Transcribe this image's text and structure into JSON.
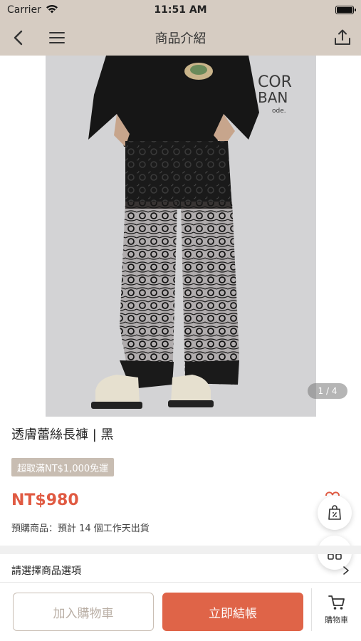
{
  "status_bar": {
    "carrier": "Carrier",
    "time": "11:51 AM"
  },
  "nav": {
    "title": "商品介紹"
  },
  "hero": {
    "counter": "1 / 4",
    "logo_line1": "COR",
    "logo_line2": "BAN",
    "logo_line3": "ode."
  },
  "product": {
    "title": "透膚蕾絲長褲 | 黑",
    "promo": "超取滿NT$1,000免運",
    "price": "NT$980",
    "preorder": "預購商品：預計 14 個工作天出貨"
  },
  "options": {
    "label": "請選擇商品選項"
  },
  "bottom": {
    "add_to_cart": "加入購物車",
    "checkout": "立即結帳",
    "cart_label": "購物車"
  },
  "colors": {
    "header_bg": "#d6ccc2",
    "accent": "#df6448",
    "price": "#e05a42"
  }
}
